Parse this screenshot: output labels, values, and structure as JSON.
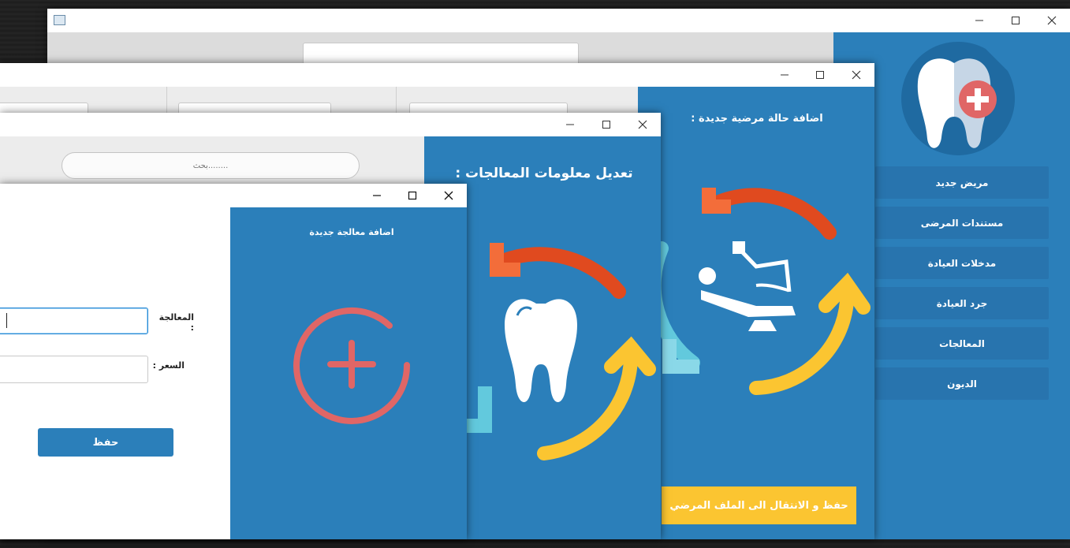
{
  "main_window": {
    "menu": [
      {
        "label": "مريض جديد"
      },
      {
        "label": "مستندات المرضى"
      },
      {
        "label": "مدخلات العيادة"
      },
      {
        "label": "جرد العيادة"
      },
      {
        "label": "المعالجات"
      },
      {
        "label": "الديون"
      }
    ]
  },
  "patient_window": {
    "title": "اضافة حالة مرضية جديدة :",
    "save_go_label": "حفظ و الانتقال الى الملف المرضي"
  },
  "edit_window": {
    "title": "تعديل معلومات المعالجات :",
    "search_placeholder": "بحث........"
  },
  "add_window": {
    "title": "اضافة معالجة جديدة",
    "treatment_label": "المعالجة :",
    "price_label": "السعر :",
    "treatment_value": "",
    "price_value": "",
    "save_label": "حفظ"
  },
  "colors": {
    "panel_blue": "#2b7fba",
    "menu_blue": "#2874ae",
    "accent_yellow": "#fbc531",
    "accent_red": "#e04a1f",
    "accent_cyan": "#62c9dd",
    "plus_red": "#e06666"
  }
}
